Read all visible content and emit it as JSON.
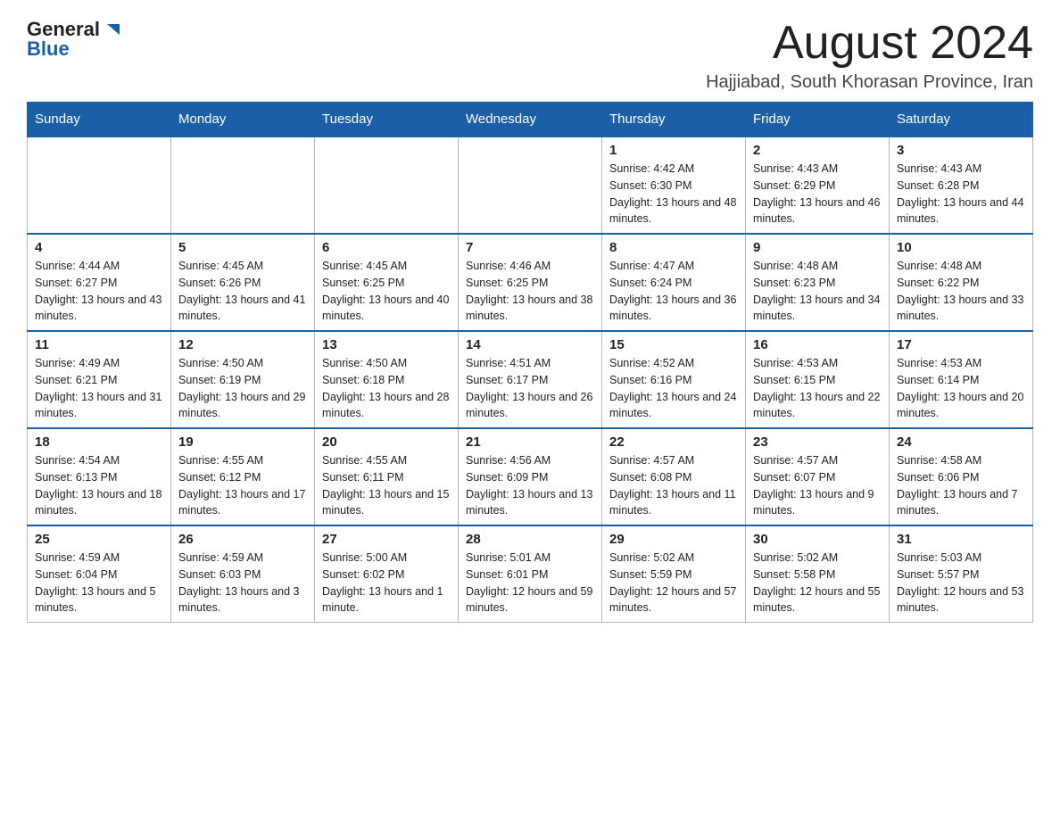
{
  "header": {
    "logo": {
      "text_general": "General",
      "text_blue": "Blue",
      "tagline": "GeneralBlue"
    },
    "title": "August 2024",
    "subtitle": "Hajjiabad, South Khorasan Province, Iran"
  },
  "weekdays": [
    "Sunday",
    "Monday",
    "Tuesday",
    "Wednesday",
    "Thursday",
    "Friday",
    "Saturday"
  ],
  "weeks": [
    {
      "days": [
        {
          "empty": true
        },
        {
          "empty": true
        },
        {
          "empty": true
        },
        {
          "empty": true
        },
        {
          "num": "1",
          "sunrise": "4:42 AM",
          "sunset": "6:30 PM",
          "daylight": "13 hours and 48 minutes."
        },
        {
          "num": "2",
          "sunrise": "4:43 AM",
          "sunset": "6:29 PM",
          "daylight": "13 hours and 46 minutes."
        },
        {
          "num": "3",
          "sunrise": "4:43 AM",
          "sunset": "6:28 PM",
          "daylight": "13 hours and 44 minutes."
        }
      ]
    },
    {
      "days": [
        {
          "num": "4",
          "sunrise": "4:44 AM",
          "sunset": "6:27 PM",
          "daylight": "13 hours and 43 minutes."
        },
        {
          "num": "5",
          "sunrise": "4:45 AM",
          "sunset": "6:26 PM",
          "daylight": "13 hours and 41 minutes."
        },
        {
          "num": "6",
          "sunrise": "4:45 AM",
          "sunset": "6:25 PM",
          "daylight": "13 hours and 40 minutes."
        },
        {
          "num": "7",
          "sunrise": "4:46 AM",
          "sunset": "6:25 PM",
          "daylight": "13 hours and 38 minutes."
        },
        {
          "num": "8",
          "sunrise": "4:47 AM",
          "sunset": "6:24 PM",
          "daylight": "13 hours and 36 minutes."
        },
        {
          "num": "9",
          "sunrise": "4:48 AM",
          "sunset": "6:23 PM",
          "daylight": "13 hours and 34 minutes."
        },
        {
          "num": "10",
          "sunrise": "4:48 AM",
          "sunset": "6:22 PM",
          "daylight": "13 hours and 33 minutes."
        }
      ]
    },
    {
      "days": [
        {
          "num": "11",
          "sunrise": "4:49 AM",
          "sunset": "6:21 PM",
          "daylight": "13 hours and 31 minutes."
        },
        {
          "num": "12",
          "sunrise": "4:50 AM",
          "sunset": "6:19 PM",
          "daylight": "13 hours and 29 minutes."
        },
        {
          "num": "13",
          "sunrise": "4:50 AM",
          "sunset": "6:18 PM",
          "daylight": "13 hours and 28 minutes."
        },
        {
          "num": "14",
          "sunrise": "4:51 AM",
          "sunset": "6:17 PM",
          "daylight": "13 hours and 26 minutes."
        },
        {
          "num": "15",
          "sunrise": "4:52 AM",
          "sunset": "6:16 PM",
          "daylight": "13 hours and 24 minutes."
        },
        {
          "num": "16",
          "sunrise": "4:53 AM",
          "sunset": "6:15 PM",
          "daylight": "13 hours and 22 minutes."
        },
        {
          "num": "17",
          "sunrise": "4:53 AM",
          "sunset": "6:14 PM",
          "daylight": "13 hours and 20 minutes."
        }
      ]
    },
    {
      "days": [
        {
          "num": "18",
          "sunrise": "4:54 AM",
          "sunset": "6:13 PM",
          "daylight": "13 hours and 18 minutes."
        },
        {
          "num": "19",
          "sunrise": "4:55 AM",
          "sunset": "6:12 PM",
          "daylight": "13 hours and 17 minutes."
        },
        {
          "num": "20",
          "sunrise": "4:55 AM",
          "sunset": "6:11 PM",
          "daylight": "13 hours and 15 minutes."
        },
        {
          "num": "21",
          "sunrise": "4:56 AM",
          "sunset": "6:09 PM",
          "daylight": "13 hours and 13 minutes."
        },
        {
          "num": "22",
          "sunrise": "4:57 AM",
          "sunset": "6:08 PM",
          "daylight": "13 hours and 11 minutes."
        },
        {
          "num": "23",
          "sunrise": "4:57 AM",
          "sunset": "6:07 PM",
          "daylight": "13 hours and 9 minutes."
        },
        {
          "num": "24",
          "sunrise": "4:58 AM",
          "sunset": "6:06 PM",
          "daylight": "13 hours and 7 minutes."
        }
      ]
    },
    {
      "days": [
        {
          "num": "25",
          "sunrise": "4:59 AM",
          "sunset": "6:04 PM",
          "daylight": "13 hours and 5 minutes."
        },
        {
          "num": "26",
          "sunrise": "4:59 AM",
          "sunset": "6:03 PM",
          "daylight": "13 hours and 3 minutes."
        },
        {
          "num": "27",
          "sunrise": "5:00 AM",
          "sunset": "6:02 PM",
          "daylight": "13 hours and 1 minute."
        },
        {
          "num": "28",
          "sunrise": "5:01 AM",
          "sunset": "6:01 PM",
          "daylight": "12 hours and 59 minutes."
        },
        {
          "num": "29",
          "sunrise": "5:02 AM",
          "sunset": "5:59 PM",
          "daylight": "12 hours and 57 minutes."
        },
        {
          "num": "30",
          "sunrise": "5:02 AM",
          "sunset": "5:58 PM",
          "daylight": "12 hours and 55 minutes."
        },
        {
          "num": "31",
          "sunrise": "5:03 AM",
          "sunset": "5:57 PM",
          "daylight": "12 hours and 53 minutes."
        }
      ]
    }
  ]
}
